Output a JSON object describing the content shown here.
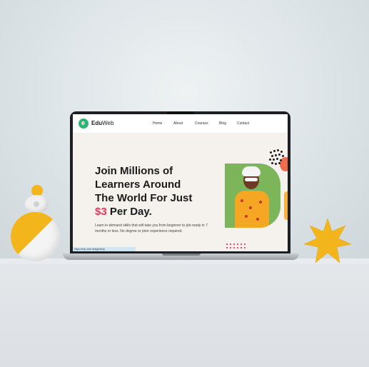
{
  "site": {
    "logo_mark": "e",
    "logo_bold": "Edu",
    "logo_light": "Web",
    "nav": [
      "Home",
      "About",
      "Courses",
      "Blog",
      "Contact"
    ]
  },
  "hero": {
    "line1": "Join Millions of",
    "line2": "Learners Around",
    "line3": "The World For Just",
    "price": "$3",
    "line4_rest": " Per Day.",
    "subtext": "Learn in-demand skills that will take you from beginner to job-ready in 7 months or less. No degree or prior experience required."
  },
  "status_bar": {
    "url": "https://edu-web.design/#top"
  },
  "colors": {
    "accent_green": "#2bb673",
    "price_pink": "#e8365d",
    "deco_yellow": "#f2b51c"
  }
}
